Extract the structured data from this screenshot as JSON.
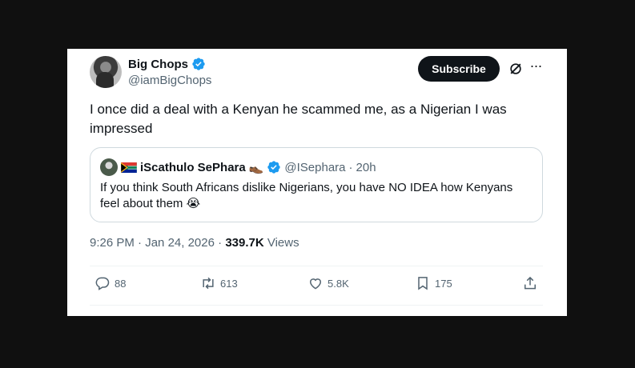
{
  "author": {
    "name": "Big Chops",
    "handle": "@iamBigChops"
  },
  "subscribe_label": "Subscribe",
  "tweet_text": "I once did a deal with a Kenyan he scammed me, as a Nigerian I was impressed",
  "quote": {
    "name": "iScathulo SePhara",
    "name_emoji": "👞",
    "handle": "@ISephara",
    "sep": "·",
    "time": "20h",
    "text": "If you think South Africans dislike Nigerians, you have NO IDEA how Kenyans feel about them 😭"
  },
  "meta": {
    "time": "9:26 PM",
    "sep1": "·",
    "date": "Jan 24, 2026",
    "sep2": "·",
    "views_count": "339.7K",
    "views_label": "Views"
  },
  "actions": {
    "replies": "88",
    "reposts": "613",
    "likes": "5.8K",
    "bookmarks": "175"
  },
  "colors": {
    "verified": "#1d9bf0",
    "muted": "#536471",
    "text": "#0f1419"
  },
  "icons": [
    "verified-icon",
    "grok-icon",
    "more-icon",
    "reply-icon",
    "repost-icon",
    "like-icon",
    "bookmark-icon",
    "share-icon",
    "south-africa-flag-icon"
  ]
}
